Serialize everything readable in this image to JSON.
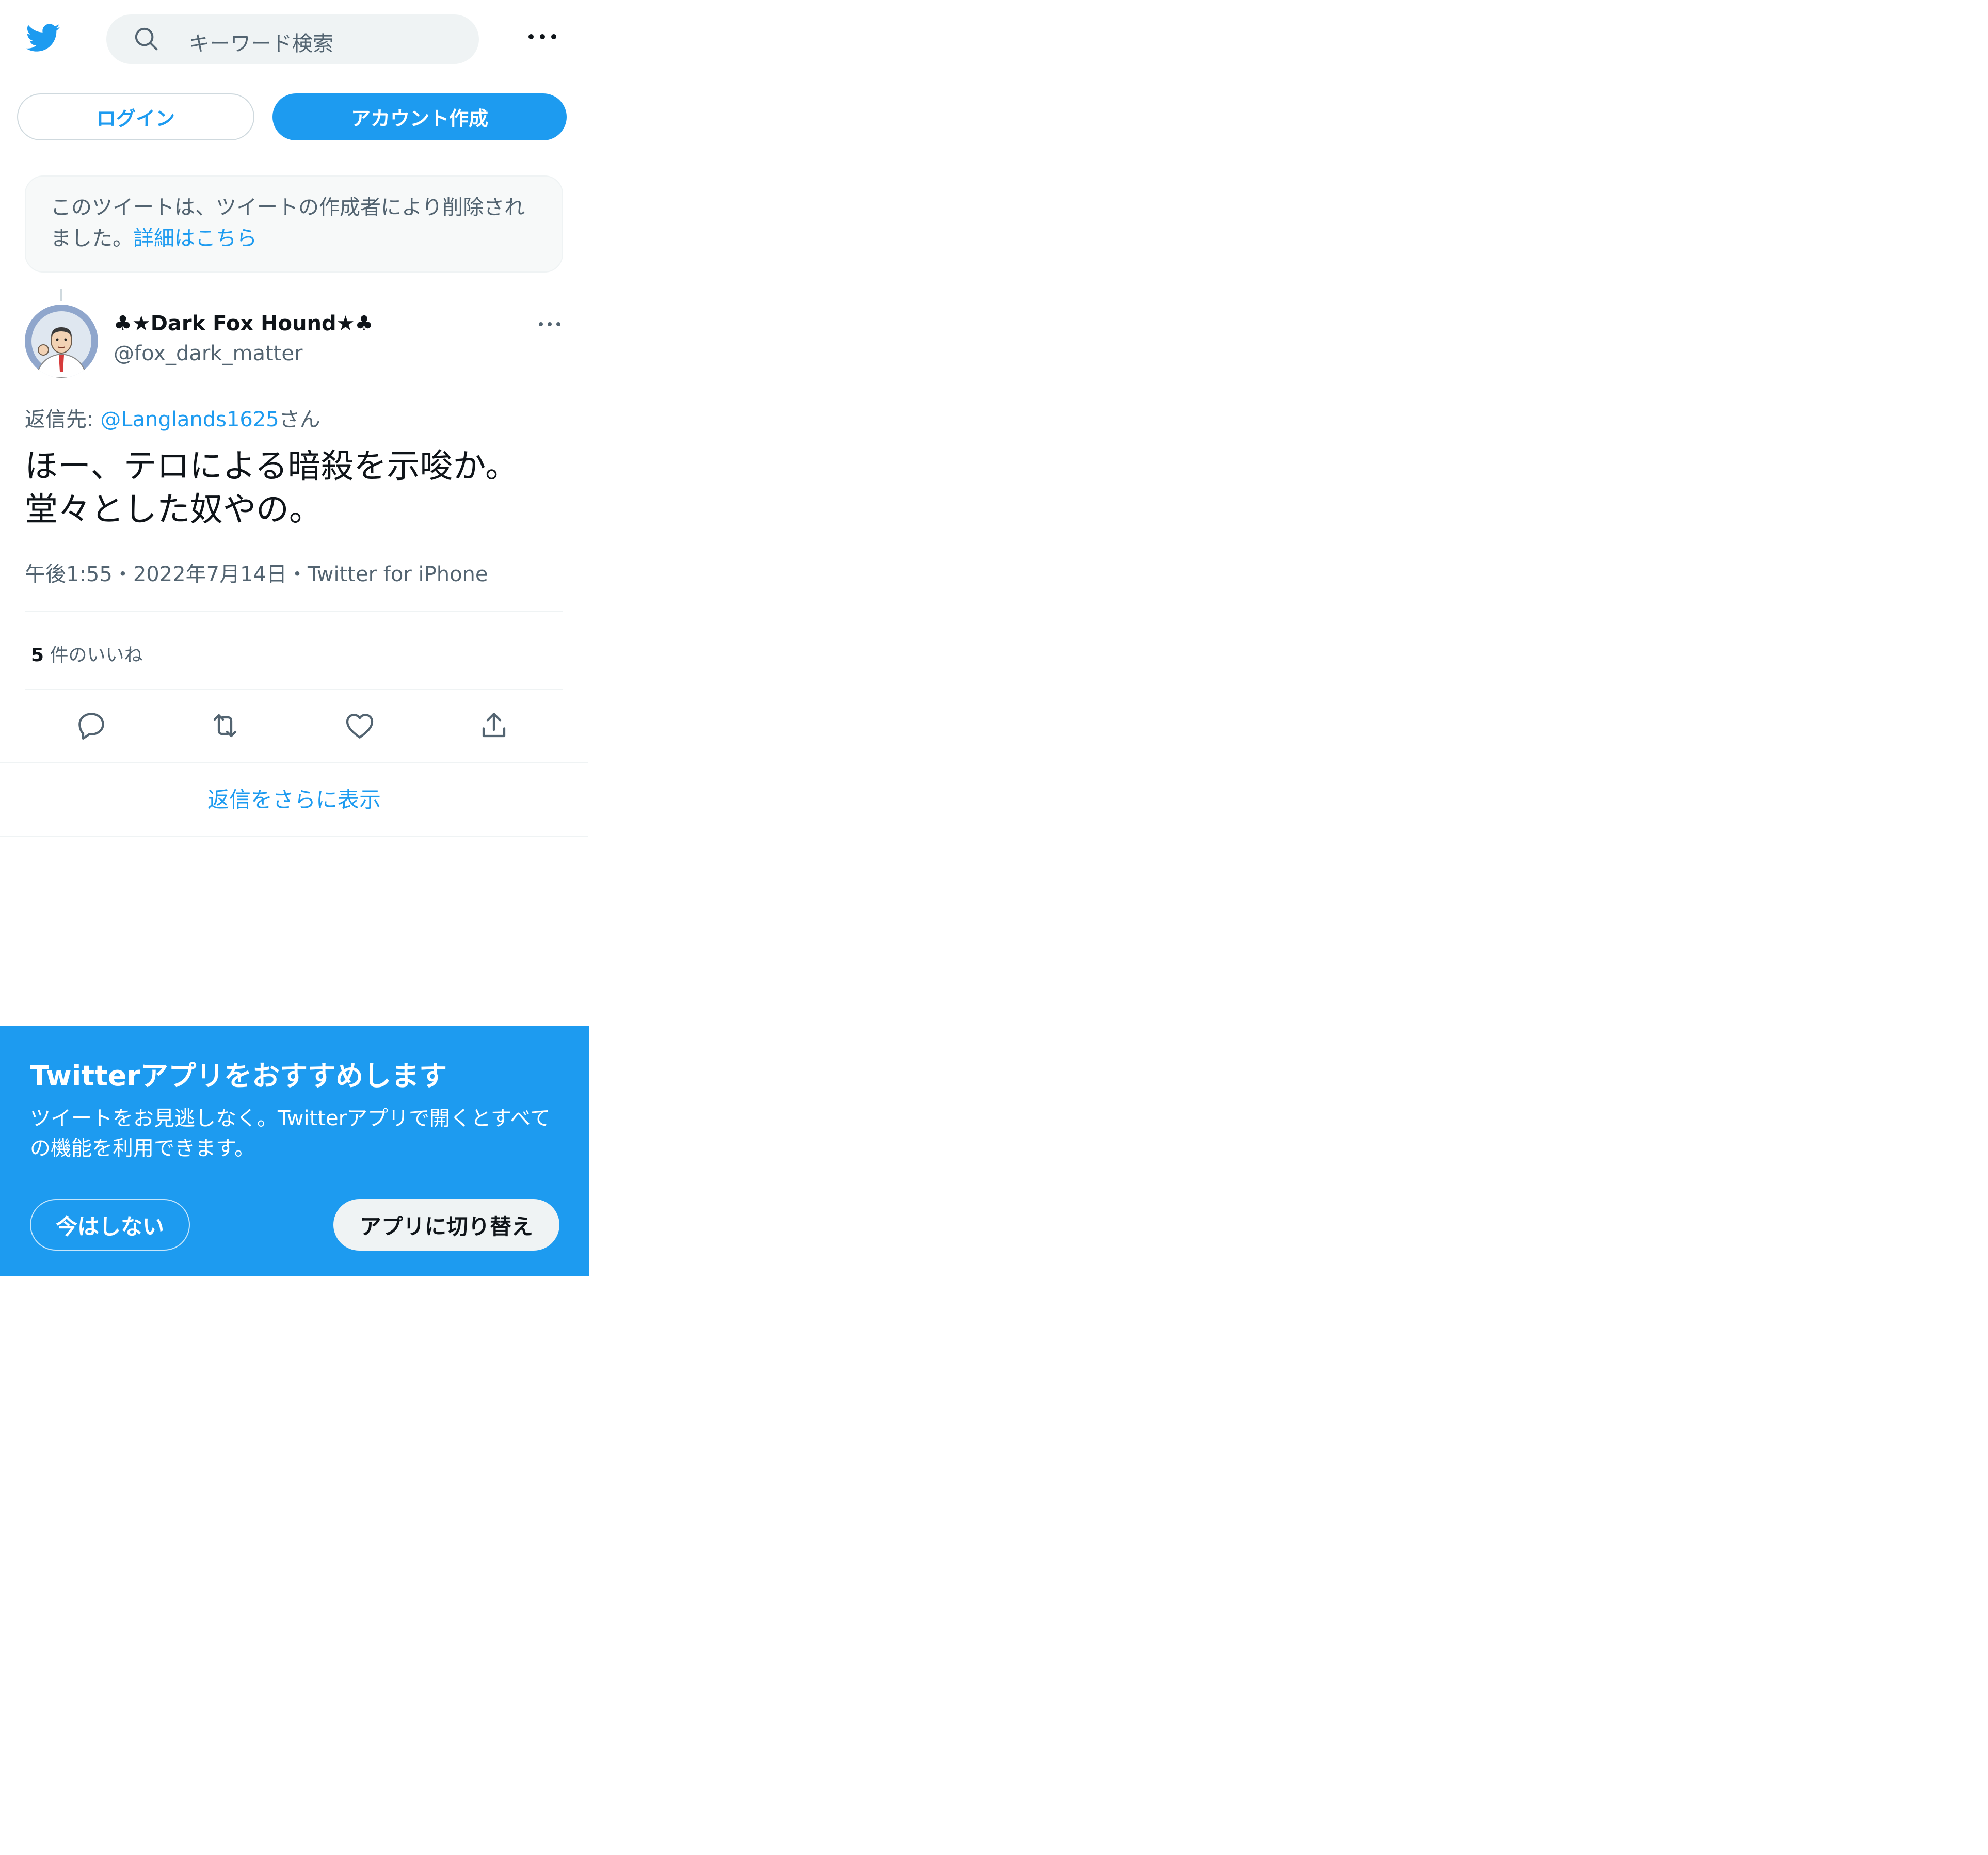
{
  "header": {
    "logo_icon": "twitter-bird-icon",
    "search_placeholder": "キーワード検索",
    "search_icon": "search-icon",
    "more_icon": "more-dots-icon"
  },
  "auth": {
    "login_label": "ログイン",
    "signup_label": "アカウント作成"
  },
  "deleted_notice": {
    "text": "このツイートは、ツイートの作成者により削除されました。",
    "link": "詳細はこちら"
  },
  "tweet": {
    "display_name": "♣★Dark Fox Hound★♣",
    "handle": "@fox_dark_matter",
    "replying_prefix": "返信先: ",
    "replying_mention": "@Langlands1625",
    "replying_suffix": "さん",
    "text_line1": "ほー、テロによる暗殺を示唆か。",
    "text_line2": "堂々とした奴やの。",
    "time": "午後1:55",
    "date": "2022年7月14日",
    "source": "Twitter for iPhone",
    "separator": "・",
    "likes_count": "5",
    "likes_label": "件のいいね"
  },
  "actions": [
    "reply-icon",
    "retweet-icon",
    "like-icon",
    "share-icon"
  ],
  "more_replies": "返信をさらに表示",
  "app_banner": {
    "title": "Twitterアプリをおすすめします",
    "description": "ツイートをお見逃しなく。Twitterアプリで開くとすべての機能を利用できます。",
    "not_now": "今はしない",
    "switch": "アプリに切り替え"
  },
  "colors": {
    "accent": "#1d9bf0",
    "text_primary": "#0f1419",
    "text_secondary": "#536471",
    "border": "#eff3f4"
  }
}
